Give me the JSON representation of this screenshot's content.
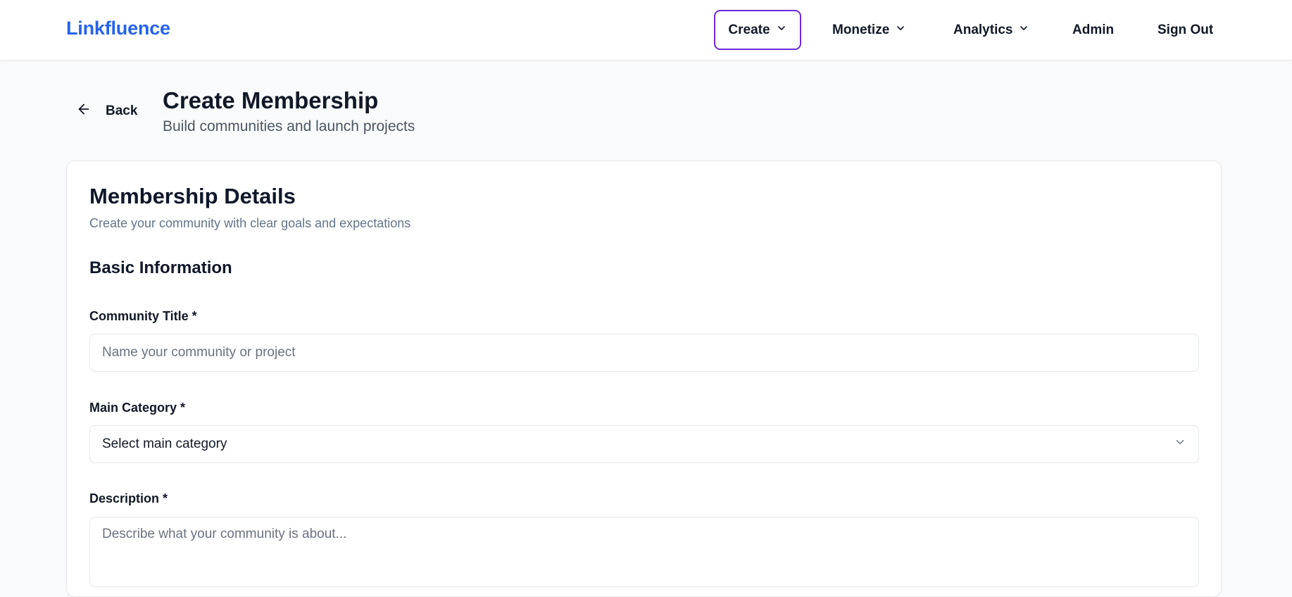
{
  "header": {
    "brand": "Linkfluence",
    "nav": {
      "create": "Create",
      "monetize": "Monetize",
      "analytics": "Analytics",
      "admin": "Admin",
      "signout": "Sign Out"
    }
  },
  "page": {
    "back_label": "Back",
    "title": "Create Membership",
    "subtitle": "Build communities and launch projects"
  },
  "card": {
    "title": "Membership Details",
    "subtitle": "Create your community with clear goals and expectations",
    "section_title": "Basic Information",
    "fields": {
      "title_label": "Community Title *",
      "title_placeholder": "Name your community or project",
      "title_value": "",
      "category_label": "Main Category *",
      "category_value": "Select main category",
      "description_label": "Description *",
      "description_placeholder": "Describe what your community is about...",
      "description_value": ""
    }
  },
  "colors": {
    "brand": "#2563eb",
    "active_nav_border": "#6d28d9",
    "background": "#f9fafb"
  }
}
